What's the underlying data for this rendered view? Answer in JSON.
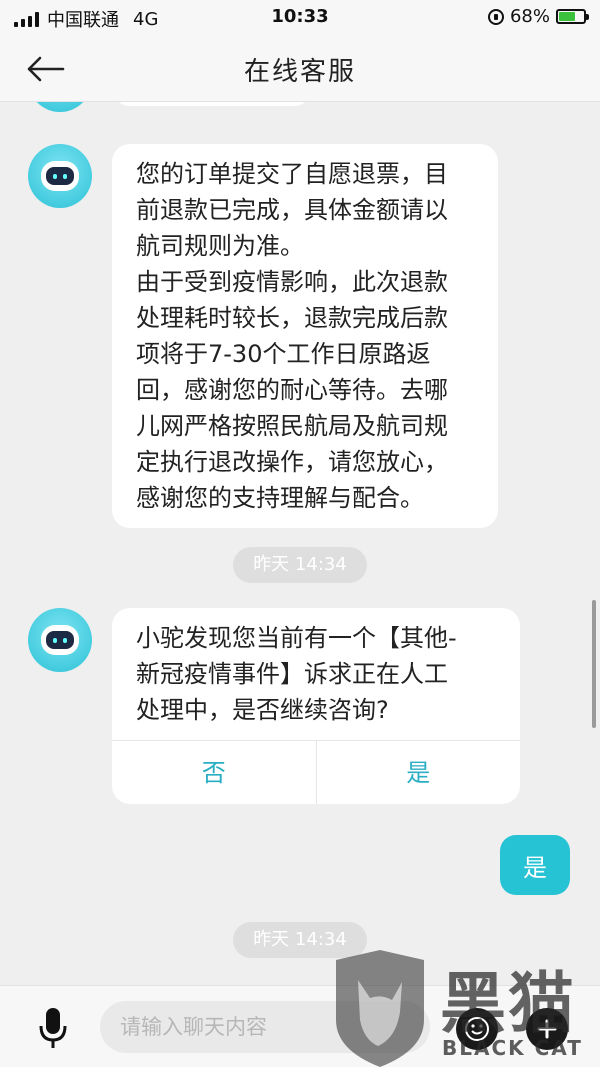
{
  "status_bar": {
    "carrier": "中国联通",
    "network": "4G",
    "time": "10:33",
    "battery": "68%",
    "battery_level": 0.68
  },
  "header": {
    "title": "在线客服"
  },
  "messages": [
    {
      "from": "bot",
      "text": "您的订单提交了自愿退票，目\n前退款已完成，具体金额请以\n航司规则为准。\n由于受到疫情影响，此次退款\n处理耗时较长，退款完成后款\n项将于7-30个工作日原路返\n回，感谢您的耐心等待。去哪\n儿网严格按照民航局及航司规\n定执行退改操作，请您放心，\n感谢您的支持理解与配合。"
    },
    {
      "from": "time",
      "text": "昨天 14:34"
    },
    {
      "from": "bot",
      "text": "小驼发现您当前有一个【其他-\n新冠疫情事件】诉求正在人工\n处理中，是否继续咨询?",
      "choices": [
        "否",
        "是"
      ]
    },
    {
      "from": "user",
      "text": "是"
    },
    {
      "from": "time",
      "text": "昨天 14:34"
    }
  ],
  "input": {
    "placeholder": "请输入聊天内容"
  },
  "watermark": {
    "big": "黑猫",
    "small": "BLACK CAT"
  },
  "colors": {
    "accent": "#26c3d4",
    "choice_text": "#2aaec4",
    "background": "#efefef"
  },
  "icons": [
    "back-arrow-icon",
    "microphone-icon",
    "emoji-icon",
    "plus-icon",
    "robot-avatar-icon"
  ]
}
